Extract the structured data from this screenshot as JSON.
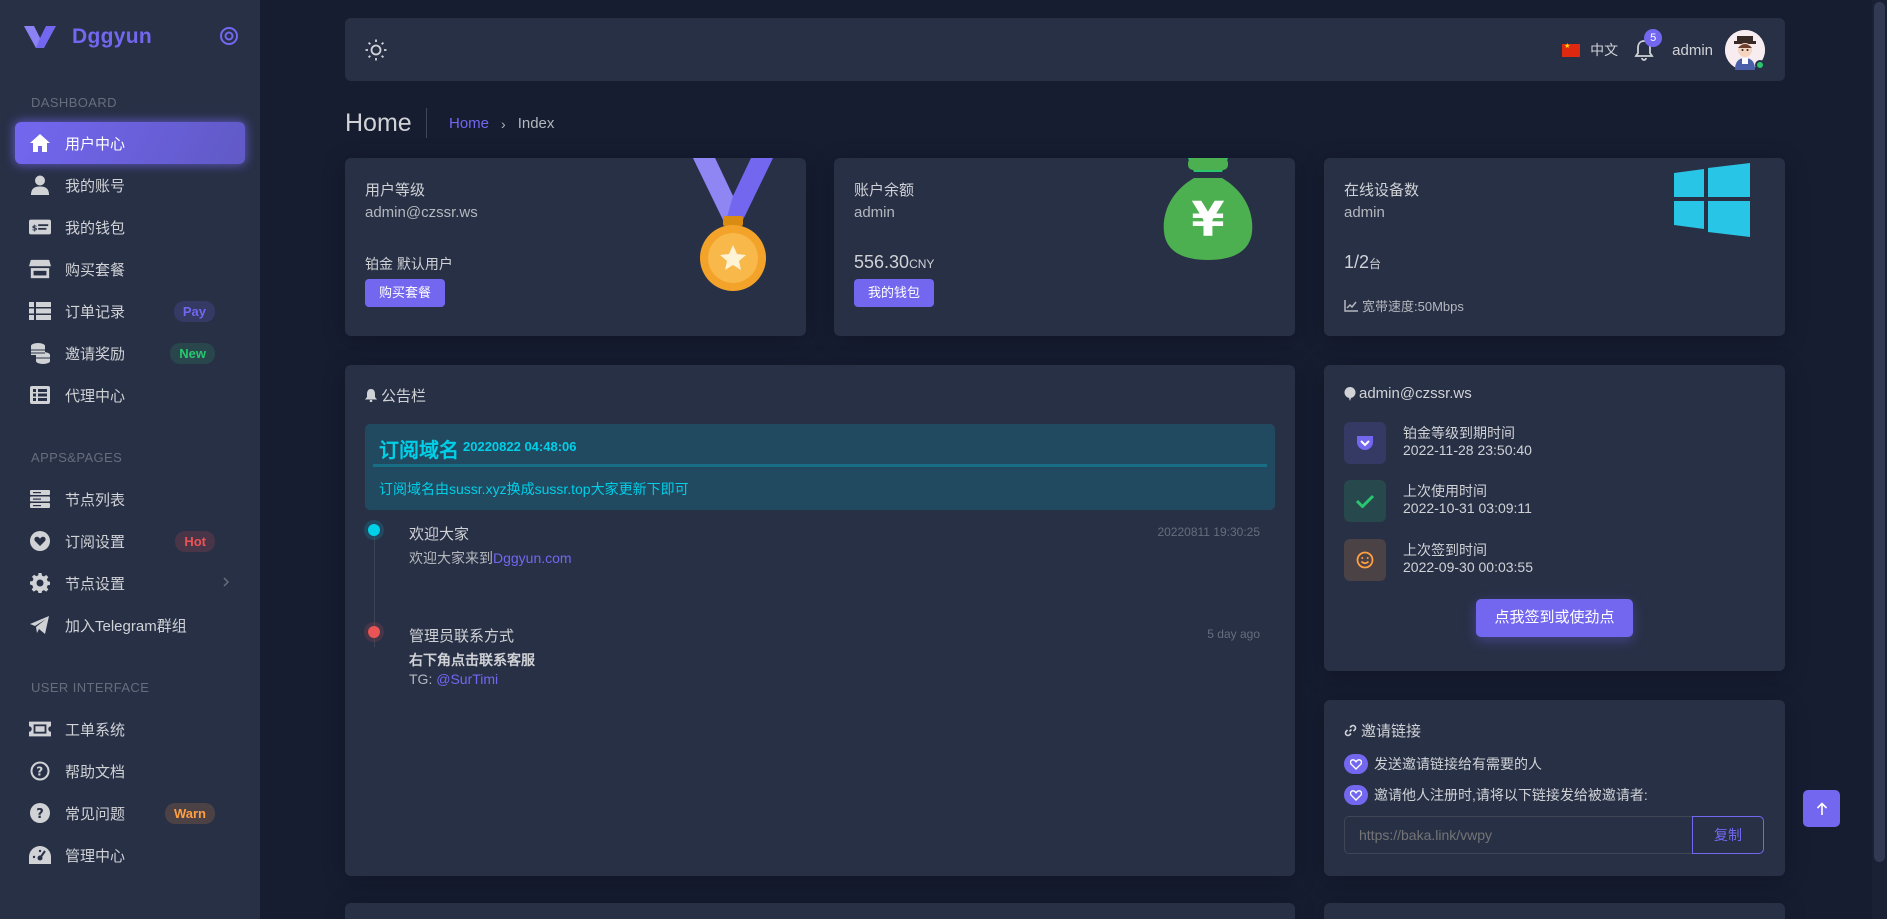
{
  "brand": {
    "name": "Dggyun"
  },
  "sidebar": {
    "sections": [
      {
        "heading": "DASHBOARD",
        "items": [
          {
            "label": "用户中心",
            "icon": "home-icon",
            "active": true
          },
          {
            "label": "我的账号",
            "icon": "user-icon"
          },
          {
            "label": "我的钱包",
            "icon": "wallet-icon"
          },
          {
            "label": "购买套餐",
            "icon": "store-icon"
          },
          {
            "label": "订单记录",
            "icon": "list-icon",
            "badge": "Pay"
          },
          {
            "label": "邀请奖励",
            "icon": "coins-icon",
            "badge": "New"
          },
          {
            "label": "代理中心",
            "icon": "list-alt-icon"
          }
        ]
      },
      {
        "heading": "APPS&PAGES",
        "items": [
          {
            "label": "节点列表",
            "icon": "server-icon"
          },
          {
            "label": "订阅设置",
            "icon": "heart-icon",
            "badge": "Hot"
          },
          {
            "label": "节点设置",
            "icon": "gear-icon",
            "submenu": true
          },
          {
            "label": "加入Telegram群组",
            "icon": "telegram-icon"
          }
        ]
      },
      {
        "heading": "USER INTERFACE",
        "items": [
          {
            "label": "工单系统",
            "icon": "ticket-icon"
          },
          {
            "label": "帮助文档",
            "icon": "help-icon"
          },
          {
            "label": "常见问题",
            "icon": "question-icon",
            "badge": "Warn"
          },
          {
            "label": "管理中心",
            "icon": "dashboard-icon"
          }
        ]
      }
    ]
  },
  "navbar": {
    "language": "中文",
    "notifications": "5",
    "username": "admin"
  },
  "breadcrumb": {
    "title": "Home",
    "home": "Home",
    "current": "Index"
  },
  "stats": {
    "level": {
      "title": "用户等级",
      "email": "admin@czssr.ws",
      "tier": "铂金 默认用户",
      "button": "购买套餐"
    },
    "balance": {
      "title": "账户余额",
      "user": "admin",
      "amount": "556.30",
      "currency": "CNY",
      "button": "我的钱包"
    },
    "devices": {
      "title": "在线设备数",
      "user": "admin",
      "count": "1/2",
      "unit": "台",
      "speed": "宽带速度:50Mbps"
    }
  },
  "announcements": {
    "heading": "公告栏",
    "pinned": {
      "title": "订阅域名",
      "date": "20220822 04:48:06",
      "body": "订阅域名由sussr.xyz换成sussr.top大家更新下即可"
    },
    "timeline": [
      {
        "title": "欢迎大家",
        "time": "20220811 19:30:25",
        "text": "欢迎大家来到",
        "link": "Dggyun.com"
      },
      {
        "title": "管理员联系方式",
        "time": "5 day ago",
        "text": "右下角点击联系客服",
        "tg_label": "TG: ",
        "tg_link": "@SurTimi"
      }
    ]
  },
  "account": {
    "heading": "admin@czssr.ws",
    "rows": [
      {
        "label": "铂金等级到期时间",
        "value": "2022-11-28 23:50:40",
        "icon": "pocket-icon"
      },
      {
        "label": "上次使用时间",
        "value": "2022-10-31 03:09:11",
        "icon": "check-icon"
      },
      {
        "label": "上次签到时间",
        "value": "2022-09-30 00:03:55",
        "icon": "smile-icon"
      }
    ],
    "checkin_button": "点我签到或使劲点"
  },
  "invite": {
    "heading": "邀请链接",
    "line1": "发送邀请链接给有需要的人",
    "line2": "邀请他人注册时,请将以下链接发给被邀请者:",
    "link_placeholder": "https://baka.link/vwpy",
    "copy_button": "复制"
  },
  "colors": {
    "primary": "#7367f0",
    "info": "#00cfe8",
    "success": "#28c76f",
    "danger": "#ea5455",
    "warning": "#ff9f43",
    "background": "#161d31",
    "card": "#283046"
  }
}
